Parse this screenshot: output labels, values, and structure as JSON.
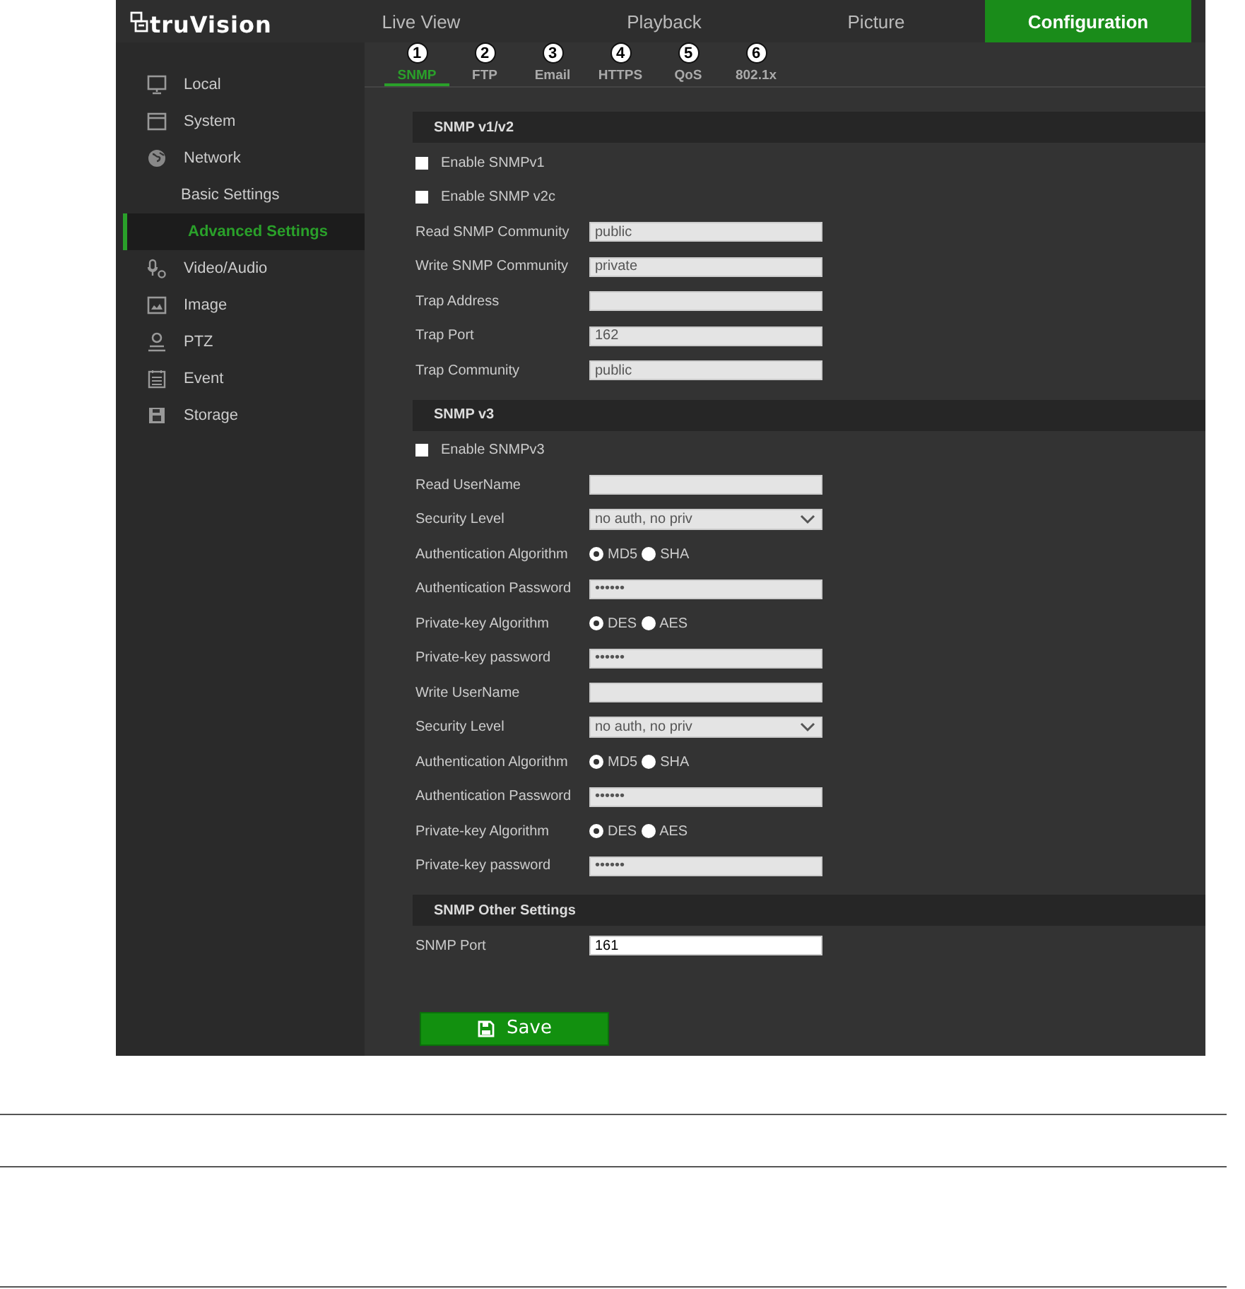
{
  "logo": {
    "text": "truVision"
  },
  "top_tabs": [
    {
      "label": "Live View",
      "selected": false
    },
    {
      "label": "Playback",
      "selected": false
    },
    {
      "label": "Picture",
      "selected": false
    },
    {
      "label": "Configuration",
      "selected": true
    }
  ],
  "sidebar": {
    "items": [
      {
        "label": "Local",
        "selected": false
      },
      {
        "label": "System",
        "selected": false
      },
      {
        "label": "Network",
        "selected": false,
        "children": [
          {
            "label": "Basic Settings",
            "selected": false
          },
          {
            "label": "Advanced Settings",
            "selected": true
          }
        ]
      },
      {
        "label": "Video/Audio",
        "selected": false
      },
      {
        "label": "Image",
        "selected": false
      },
      {
        "label": "PTZ",
        "selected": false
      },
      {
        "label": "Event",
        "selected": false
      },
      {
        "label": "Storage",
        "selected": false
      }
    ]
  },
  "sub_tabs": [
    {
      "callout": "1",
      "label": "SNMP",
      "selected": true
    },
    {
      "callout": "2",
      "label": "FTP",
      "selected": false
    },
    {
      "callout": "3",
      "label": "Email",
      "selected": false
    },
    {
      "callout": "4",
      "label": "HTTPS",
      "selected": false
    },
    {
      "callout": "5",
      "label": "QoS",
      "selected": false
    },
    {
      "callout": "6",
      "label": "802.1x",
      "selected": false
    }
  ],
  "sections": [
    {
      "title": "SNMP v1/v2",
      "rows": [
        {
          "kind": "checkbox",
          "label": "Enable SNMPv1",
          "checked": false
        },
        {
          "kind": "checkbox",
          "label": "Enable SNMP v2c",
          "checked": false
        },
        {
          "kind": "text",
          "label": "Read SNMP Community",
          "value": "public",
          "disabled": true
        },
        {
          "kind": "text",
          "label": "Write SNMP Community",
          "value": "private",
          "disabled": true
        },
        {
          "kind": "text",
          "label": "Trap Address",
          "disabled": true
        },
        {
          "kind": "text",
          "label": "Trap Port",
          "value": "162",
          "disabled": true
        },
        {
          "kind": "text",
          "label": "Trap Community",
          "value": "public",
          "disabled": true
        }
      ]
    },
    {
      "title": "SNMP v3",
      "rows": [
        {
          "kind": "checkbox",
          "label": "Enable SNMPv3",
          "checked": false
        },
        {
          "kind": "text",
          "label": "Read UserName",
          "disabled": true
        },
        {
          "kind": "select",
          "label": "Security Level",
          "value": "no auth, no priv",
          "disabled": true
        },
        {
          "kind": "radio",
          "label": "Authentication Algorithm",
          "options": [
            {
              "label": "MD5",
              "selected": true
            },
            {
              "label": "SHA",
              "selected": false
            }
          ]
        },
        {
          "kind": "text",
          "label": "Authentication Password",
          "value": "••••••",
          "disabled": true
        },
        {
          "kind": "radio",
          "label": "Private-key Algorithm",
          "options": [
            {
              "label": "DES",
              "selected": true
            },
            {
              "label": "AES",
              "selected": false
            }
          ]
        },
        {
          "kind": "text",
          "label": "Private-key password",
          "value": "••••••",
          "disabled": true
        },
        {
          "kind": "text",
          "label": "Write UserName",
          "disabled": true
        },
        {
          "kind": "select",
          "label": "Security Level",
          "value": "no auth, no priv",
          "disabled": true
        },
        {
          "kind": "radio",
          "label": "Authentication Algorithm",
          "options": [
            {
              "label": "MD5",
              "selected": true
            },
            {
              "label": "SHA",
              "selected": false
            }
          ]
        },
        {
          "kind": "text",
          "label": "Authentication Password",
          "value": "••••••",
          "disabled": true
        },
        {
          "kind": "radio",
          "label": "Private-key Algorithm",
          "options": [
            {
              "label": "DES",
              "selected": true
            },
            {
              "label": "AES",
              "selected": false
            }
          ]
        },
        {
          "kind": "text",
          "label": "Private-key password",
          "value": "••••••",
          "disabled": true
        }
      ]
    },
    {
      "title": "SNMP Other Settings",
      "rows": [
        {
          "kind": "text",
          "label": "SNMP Port",
          "value": "161",
          "disabled": false
        }
      ]
    }
  ],
  "save_button": {
    "label": "Save"
  }
}
